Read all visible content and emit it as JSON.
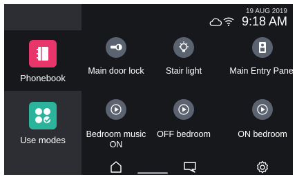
{
  "status": {
    "date": "19 AUG 2019",
    "time": "9:18 AM",
    "cloud_icon": "cloud-icon",
    "wifi_icon": "wifi-icon"
  },
  "sidebar": {
    "items": [
      {
        "label": "Phonebook",
        "icon": "phonebook-icon",
        "color": "#e8356a",
        "active": true
      },
      {
        "label": "Use modes",
        "icon": "use-modes-icon",
        "color": "#2bb39c",
        "active": false
      }
    ]
  },
  "tiles": [
    {
      "label": "Main door lock",
      "icon": "door-lock-icon"
    },
    {
      "label": "Stair light",
      "icon": "light-bulb-icon"
    },
    {
      "label": "Main Entry Panel",
      "icon": "entry-panel-icon"
    },
    {
      "label": "Bedroom music ON",
      "icon": "play-icon"
    },
    {
      "label": "OFF bedroom",
      "icon": "play-icon"
    },
    {
      "label": "ON bedroom",
      "icon": "play-icon"
    }
  ],
  "navbar": {
    "home_icon": "home-icon",
    "chat_icon": "chat-icon",
    "settings_icon": "settings-icon"
  },
  "colors": {
    "background": "#16181c",
    "sidebar": "#2c2e33",
    "tile_circle": "#5b6270"
  }
}
